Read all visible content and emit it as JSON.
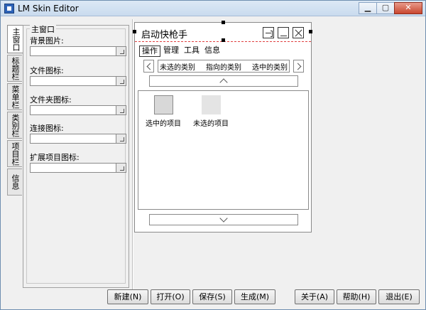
{
  "window": {
    "title": "LM Skin Editor",
    "controls": {
      "minimize": "▁",
      "maximize": "▢",
      "close": "✕"
    }
  },
  "left_tabs": [
    "主窗口",
    "标题栏",
    "菜单栏",
    "类别栏",
    "项目栏",
    "信息"
  ],
  "left_panel": {
    "group_title": "主窗口",
    "fields": [
      {
        "label": "背景图片:",
        "value": ""
      },
      {
        "label": "文件图标:",
        "value": ""
      },
      {
        "label": "文件夹图标:",
        "value": ""
      },
      {
        "label": "连接图标:",
        "value": ""
      },
      {
        "label": "扩展项目图标:",
        "value": ""
      }
    ]
  },
  "preview": {
    "title": "启动快枪手",
    "menu": [
      "操作",
      "管理",
      "工具",
      "信息"
    ],
    "categories": [
      "未选的类别",
      "指向的类别",
      "选中的类别"
    ],
    "items": [
      {
        "label": "选中的项目",
        "state": "selected"
      },
      {
        "label": "未选的项目",
        "state": "unselected"
      }
    ]
  },
  "buttons": {
    "new": "新建(N)",
    "open": "打开(O)",
    "save": "保存(S)",
    "generate": "生成(M)",
    "about": "关于(A)",
    "help": "帮助(H)",
    "exit": "退出(E)"
  },
  "colors": {
    "selection_dash": "#e04040",
    "titlebar": "#c9dbee",
    "close_button": "#c9462f"
  }
}
